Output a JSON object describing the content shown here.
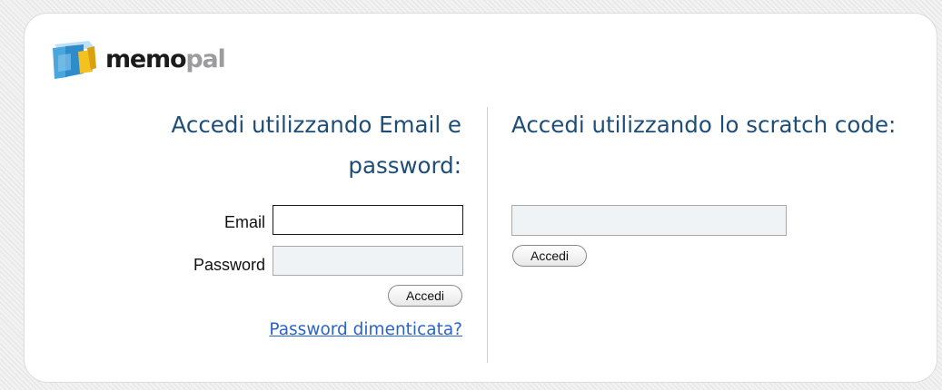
{
  "logo": {
    "text_memo": "memo",
    "text_pal": "pal",
    "icon": "memopal-cube-icon",
    "colors": {
      "memo": "#1b1b1b",
      "pal": "#9c9ca0",
      "cube_blue": "#3a9bd8",
      "cube_yellow": "#f4c21e",
      "cube_light": "#bfe0f4"
    }
  },
  "left": {
    "heading": "Accedi utilizzando Email e password:",
    "email_label": "Email",
    "email_value": "",
    "password_label": "Password",
    "password_value": "",
    "submit_label": "Accedi",
    "forgot_link": "Password dimenticata?"
  },
  "right": {
    "heading": "Accedi utilizzando lo scratch code:",
    "scratch_value": "",
    "submit_label": "Accedi"
  },
  "colors": {
    "heading": "#1e4d78",
    "link": "#2a64c8",
    "input_bg": "#eff3f6"
  }
}
